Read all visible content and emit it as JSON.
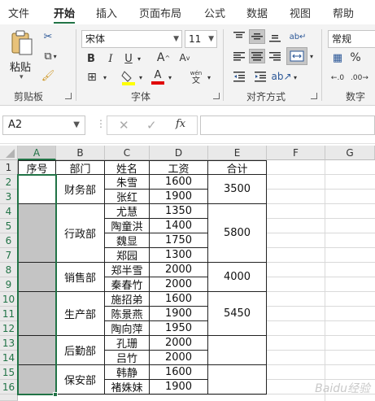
{
  "tabs": [
    "文件",
    "开始",
    "插入",
    "页面布局",
    "公式",
    "数据",
    "视图",
    "帮助"
  ],
  "active_tab": "开始",
  "clipboard": {
    "paste_label": "粘贴",
    "group_label": "剪贴板"
  },
  "font": {
    "name": "宋体",
    "size": "11",
    "group_label": "字体",
    "wen_label": "wén",
    "wen_char": "文"
  },
  "alignment": {
    "group_label": "对齐方式"
  },
  "number": {
    "format": "常规",
    "group_label": "数字"
  },
  "formula_bar": {
    "name_box": "A2",
    "formula": ""
  },
  "columns": [
    "A",
    "B",
    "C",
    "D",
    "E",
    "F",
    "G"
  ],
  "rows": [
    "1",
    "2",
    "3",
    "4",
    "5",
    "6",
    "7",
    "8",
    "9",
    "10",
    "11",
    "12",
    "13",
    "14",
    "15",
    "16"
  ],
  "table": {
    "headers": [
      "序号",
      "部门",
      "姓名",
      "工资",
      "合计"
    ],
    "departments": [
      "财务部",
      "行政部",
      "销售部",
      "生产部",
      "后勤部",
      "保安部"
    ],
    "names": [
      "朱雪",
      "张红",
      "尤慧",
      "陶童洪",
      "魏显",
      "郑园",
      "郑半雪",
      "秦春竹",
      "施招弟",
      "陈景燕",
      "陶向萍",
      "孔珊",
      "吕竹",
      "韩静",
      "褚姝妹"
    ],
    "salaries": [
      "1600",
      "1900",
      "1350",
      "1400",
      "1750",
      "1300",
      "2000",
      "2000",
      "1600",
      "1900",
      "1950",
      "2000",
      "2000",
      "1600",
      "1900"
    ],
    "totals": [
      "3500",
      "5800",
      "4000",
      "5450"
    ]
  },
  "watermark": "Baidu经验"
}
